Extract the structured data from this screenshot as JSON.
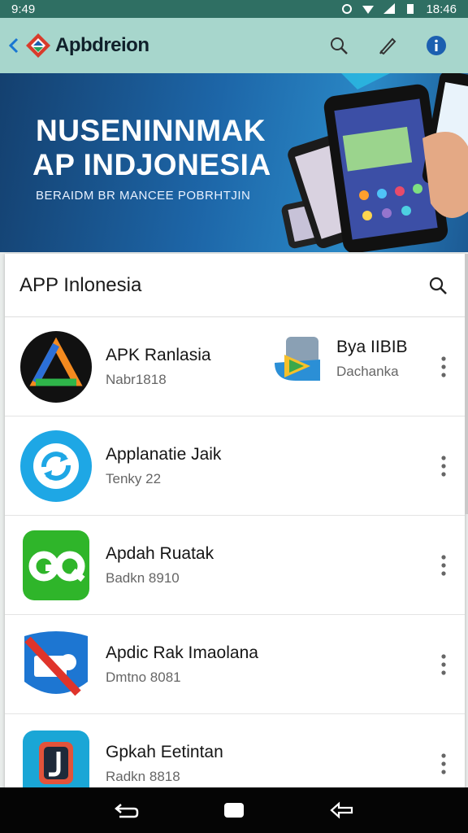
{
  "status_bar": {
    "time": "18:46",
    "left_text": "9:49"
  },
  "app_bar": {
    "title": "Apbdreion"
  },
  "banner": {
    "line1": "NUSENINNMAK",
    "line2": "AP INDJONESIA",
    "line3": "BERAIDM BR MANCEE POBRHTJIN"
  },
  "list": {
    "title": "APP Inlonesia",
    "apps": [
      {
        "name": "APK Ranlasia",
        "sub": "Nabr1818",
        "icon": "triangle-logo-icon",
        "color": "#111111"
      },
      {
        "name": "Applanatie Jaik",
        "sub": "Tenky 22",
        "icon": "sync-icon",
        "color": "#1ea7e5"
      },
      {
        "name": "Apdah Ruatak",
        "sub": "Badkn 8910",
        "icon": "go-icon",
        "color": "#2fb52a"
      },
      {
        "name": "Apdic Rak Imaolana",
        "sub": "Dmtno 8081",
        "icon": "blocked-app-icon",
        "color": "#1d76d2"
      },
      {
        "name": "Gpkah Eetintan",
        "sub": "Radkn 8818",
        "icon": "j-app-icon",
        "color": "#1aa6d6"
      }
    ],
    "second_app": {
      "name": "Bya IIBIB",
      "sub": "Dachanka",
      "icon": "folder-triangle-icon"
    }
  },
  "colors": {
    "status": "#2f6f63",
    "app_bar": "#a7d6cc",
    "nav": "#050505"
  }
}
